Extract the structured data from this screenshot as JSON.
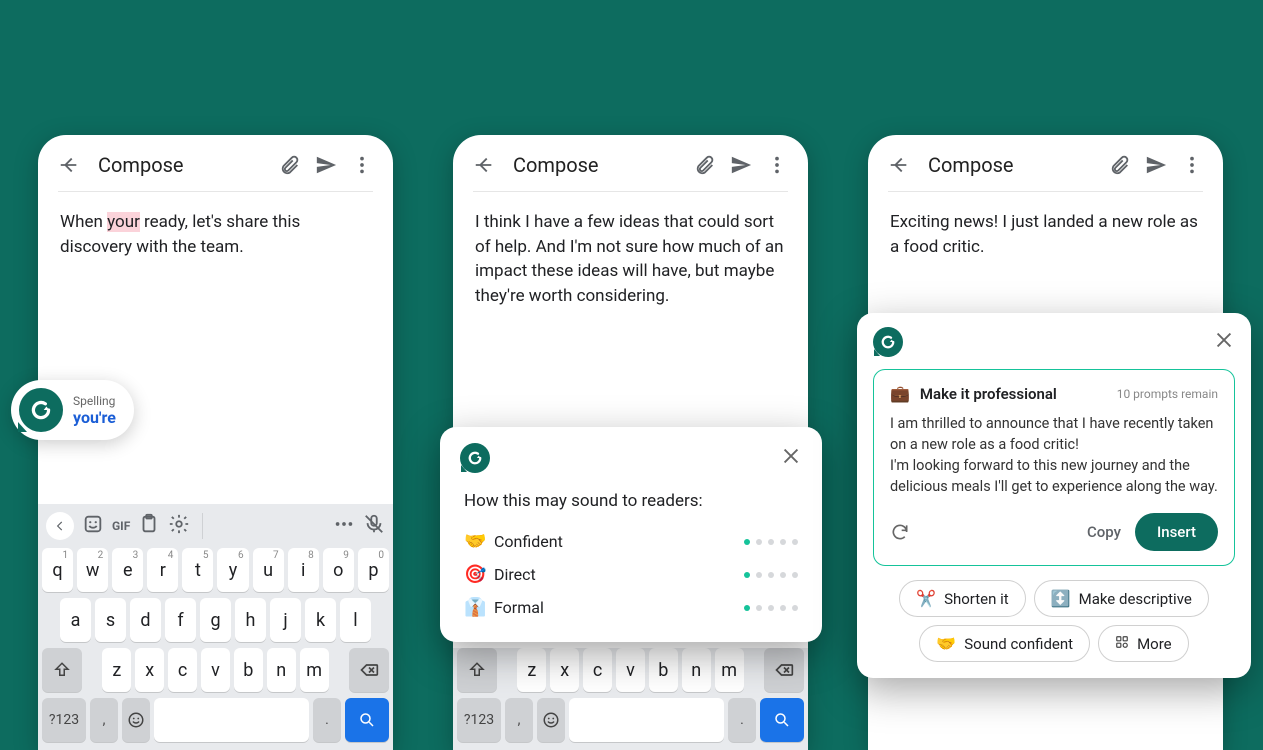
{
  "phones": {
    "p1": {
      "title": "Compose",
      "body_pre": "When ",
      "body_hi": "your",
      "body_post": " ready, let's share this discovery with the team.",
      "suggestion_label": "Spelling",
      "suggestion_word": "you're"
    },
    "p2": {
      "title": "Compose",
      "body": "I think I have a few ideas that could sort of help. And I'm not sure how much of an impact these ideas will have, but maybe they're worth considering."
    },
    "p3": {
      "title": "Compose",
      "body": "Exciting news! I just landed a new role as a food critic."
    }
  },
  "tone": {
    "title": "How this may sound to readers:",
    "rows": [
      {
        "emoji": "🤝",
        "name": "Confident",
        "level": 1
      },
      {
        "emoji": "🎯",
        "name": "Direct",
        "level": 1
      },
      {
        "emoji": "👔",
        "name": "Formal",
        "level": 1
      }
    ]
  },
  "rewrite": {
    "emoji": "💼",
    "title": "Make it professional",
    "prompts_remain": "10 prompts remain",
    "para1": "I am thrilled to announce that I have recently taken on a new role as a food critic!",
    "para2": "I'm looking forward to this new journey and the delicious meals I'll get to experience along the way.",
    "copy": "Copy",
    "insert": "Insert",
    "chips": {
      "shorten": "Shorten it",
      "descriptive": "Make descriptive",
      "confident": "Sound confident",
      "more": "More"
    },
    "chip_emoji": {
      "shorten": "✂️",
      "descriptive": "↕️",
      "confident": "🤝"
    }
  },
  "keyboard": {
    "row1": [
      [
        "q",
        "1"
      ],
      [
        "w",
        "2"
      ],
      [
        "e",
        "3"
      ],
      [
        "r",
        "4"
      ],
      [
        "t",
        "5"
      ],
      [
        "y",
        "6"
      ],
      [
        "u",
        "7"
      ],
      [
        "i",
        "8"
      ],
      [
        "o",
        "9"
      ],
      [
        "p",
        "0"
      ]
    ],
    "row2": [
      "a",
      "s",
      "d",
      "f",
      "g",
      "h",
      "j",
      "k",
      "l"
    ],
    "row3": [
      "z",
      "x",
      "c",
      "v",
      "b",
      "n",
      "m"
    ],
    "sym": "?123",
    "comma": ",",
    "period": ".",
    "gif": "GIF"
  }
}
